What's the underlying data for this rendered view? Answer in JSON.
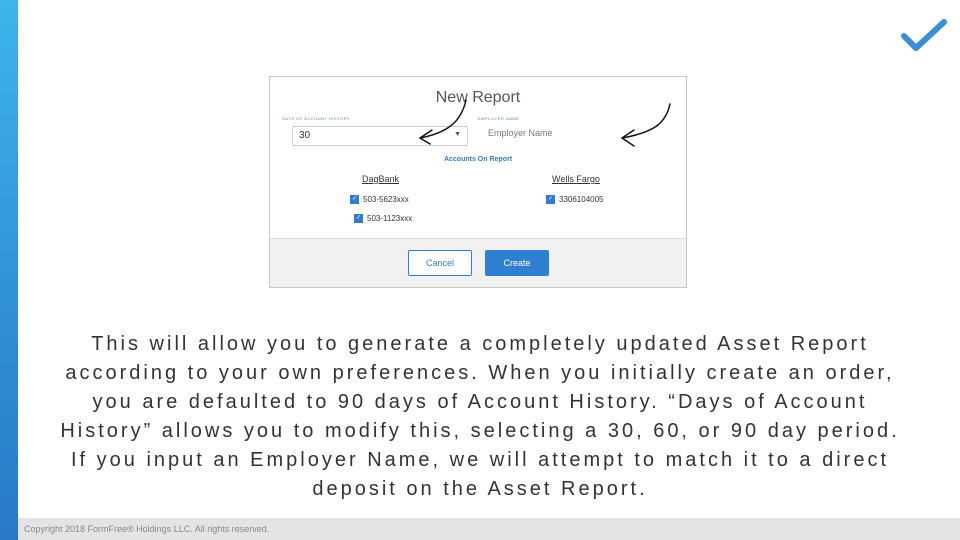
{
  "dialog": {
    "title": "New Report",
    "days_label": "DAYS OF ACCOUNT HISTORY",
    "days_value": "30",
    "employer_label": "EMPLOYER NAME",
    "employer_placeholder": "Employer Name",
    "accounts_heading": "Accounts On Report",
    "banks": [
      {
        "name": "DagBank",
        "accounts": [
          "503-5623xxx",
          "503-1123xxx"
        ]
      },
      {
        "name": "Wells Fargo",
        "accounts": [
          "3306104005"
        ]
      }
    ],
    "cancel_label": "Cancel",
    "create_label": "Create"
  },
  "caption": "This will allow you to generate a completely updated Asset Report according to your own preferences. When you initially create an order, you are defaulted to 90 days of Account History. “Days of Account History” allows you to modify this, selecting a 30, 60, or 90 day period. If you input an Employer Name, we will attempt to match it to a direct deposit on the Asset Report.",
  "footer": {
    "copyright": "Copyright 2018 FormFree® Holdings LLC. All rights reserved."
  },
  "icons": {
    "logo": "checkmark-logo-icon",
    "checkbox": "checkbox-checked-icon",
    "arrow": "hand-drawn-arrow-icon"
  },
  "colors": {
    "accent": "#2f80d0",
    "left_bar": "#3db4ea"
  }
}
